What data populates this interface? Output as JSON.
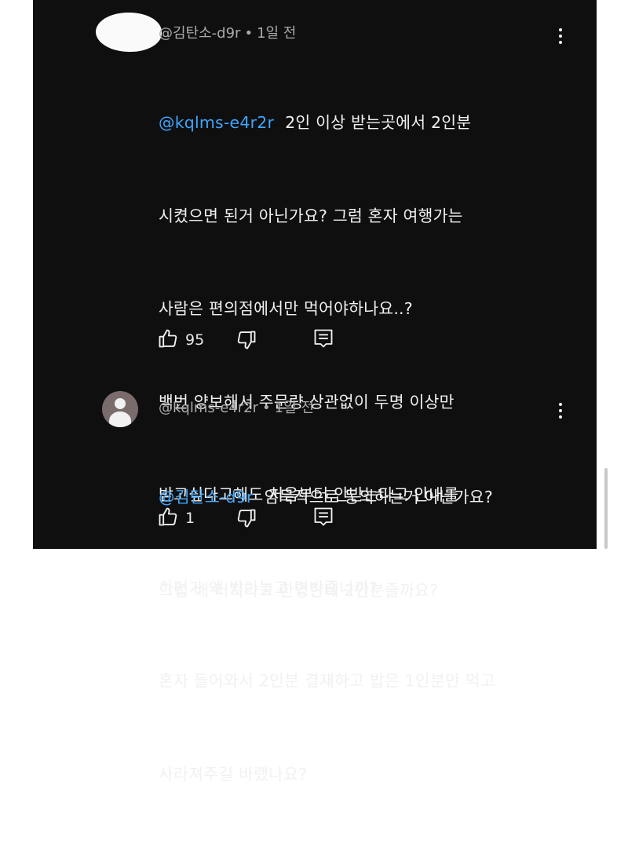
{
  "comments": [
    {
      "author": "@김탄소-d9r",
      "time": "1일 전",
      "mention": "@kqlms-e4r2r",
      "lines": [
        "2인 이상 받는곳에서 2인분",
        "시켰으면 된거 아닌가요? 그럼 혼자 여행가는",
        "사람은 편의점에서만 먹어야하나요..?",
        "백번 양보해서 주문량 상관없이 두명 이상만",
        "받고싶다고해도 처음부터 안받는다고 안내를",
        "하던가 왜 받아놓고 면박줍니까?",
        "혼자 들어와서 2인분 결재하고 밥은 1인분만 먹고",
        "사라져주길 바랬나요?"
      ],
      "likes": "95",
      "avatar_icon": "white-avatar-icon"
    },
    {
      "author": "@kqlms-e4r2r",
      "time": "1일 전",
      "mention": "@김탄소-d9r",
      "lines": [
        "암묵적으로 동의하는거 아닌가요?",
        "그럼 배 터지라고 한명한테 2인분줄까요?"
      ],
      "likes": "1",
      "avatar_icon": "default-person-avatar-icon"
    }
  ],
  "icons": {
    "like": "thumbs-up-icon",
    "dislike": "thumbs-down-icon",
    "reply": "reply-icon",
    "more": "more-vertical-icon"
  },
  "colors": {
    "background": "#0f0f0f",
    "text": "#f1f1f1",
    "meta": "#aaaaaa",
    "mention": "#3ea6ff"
  }
}
